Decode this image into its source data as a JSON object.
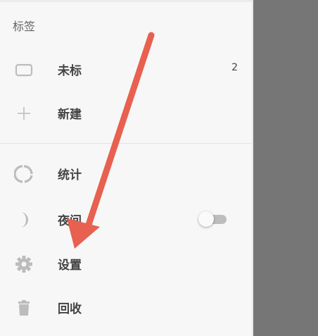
{
  "drawer": {
    "section_title": "标签",
    "items": [
      {
        "label": "未标",
        "count": "2",
        "icon": "label-outline-icon"
      },
      {
        "label": "新建",
        "icon": "plus-icon"
      },
      {
        "label": "统计",
        "icon": "donut-chart-icon"
      },
      {
        "label": "夜间",
        "icon": "moon-icon",
        "toggle_on": false
      },
      {
        "label": "设置",
        "icon": "gear-icon"
      },
      {
        "label": "回收",
        "icon": "trash-icon"
      }
    ]
  },
  "colors": {
    "drawer_bg": "#f7f7f7",
    "scrim": "#767676",
    "icon": "#bcbcbc",
    "annotation_arrow": "#e8604f"
  }
}
